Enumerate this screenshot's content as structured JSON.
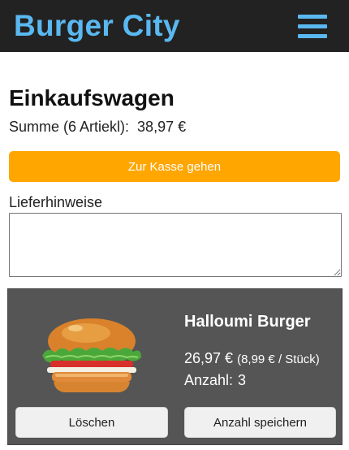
{
  "header": {
    "brand": "Burger City",
    "menu_icon": "hamburger-menu-icon",
    "brand_color": "#5ab8f0",
    "background_color": "#222222"
  },
  "cart": {
    "title": "Einkaufswagen",
    "summary_label": "Summe (6 Artiekl):",
    "summary_total": "38,97 €",
    "checkout_label": "Zur Kasse gehen",
    "checkout_color": "#ffa600",
    "notes_label": "Lieferhinweise",
    "notes_value": ""
  },
  "items": [
    {
      "name": "Halloumi Burger",
      "image_icon": "burger-image",
      "total_price": "26,97 €",
      "unit_price": "(8,99 € / Stück)",
      "quantity_label": "Anzahl:",
      "quantity": "3",
      "delete_label": "Löschen",
      "save_label": "Anzahl speichern"
    }
  ]
}
